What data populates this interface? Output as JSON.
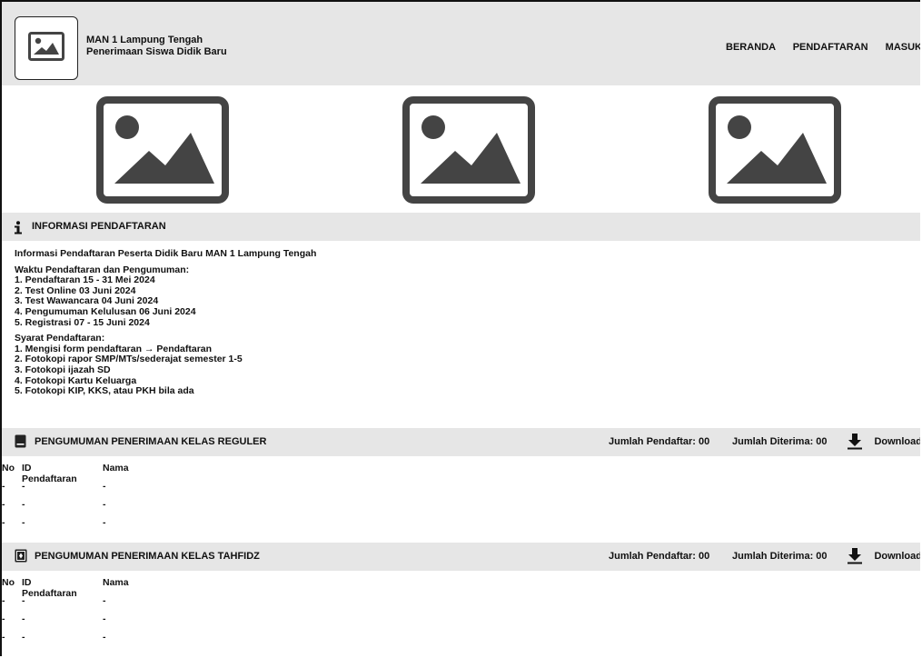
{
  "header": {
    "school_name": "MAN 1 Lampung Tengah",
    "subtitle": "Penerimaan Siswa Didik Baru",
    "nav": [
      "BERANDA",
      "PENDAFTARAN",
      "MASUK"
    ]
  },
  "info_section": {
    "title": "INFORMASI PENDAFTARAN",
    "intro": "Informasi Pendaftaran Peserta Didik Baru MAN 1 Lampung Tengah",
    "schedule_title": "Waktu Pendaftaran dan Pengumuman:",
    "schedule": [
      "1. Pendaftaran 15 - 31 Mei 2024",
      "2. Test Online 03 Juni 2024",
      "3. Test Wawancara 04 Juni 2024",
      "4. Pengumuman Kelulusan 06 Juni 2024",
      "5. Registrasi 07 - 15 Juni 2024"
    ],
    "requirements_title": "Syarat Pendaftaran:",
    "requirements": [
      "1. Mengisi form pendaftaran → Pendaftaran",
      "2. Fotokopi rapor SMP/MTs/sederajat semester 1-5",
      "3. Fotokopi ijazah SD",
      "4. Fotokopi Kartu Keluarga",
      "5. Fotokopi KIP, KKS, atau PKH bila ada"
    ]
  },
  "reguler": {
    "title": "PENGUMUMAN PENERIMAAN KELAS REGULER",
    "jumlah_pendaftar": "Jumlah Pendaftar: 00",
    "jumlah_diterima": "Jumlah Diterima: 00",
    "download": "Download",
    "columns": [
      "No",
      "ID Pendaftaran",
      "Nama"
    ],
    "rows": [
      [
        "-",
        "-",
        "-"
      ],
      [
        "-",
        "-",
        "-"
      ],
      [
        "-",
        "-",
        "-"
      ]
    ]
  },
  "tahfidz": {
    "title": "PENGUMUMAN PENERIMAAN KELAS TAHFIDZ",
    "jumlah_pendaftar": "Jumlah Pendaftar: 00",
    "jumlah_diterima": "Jumlah Diterima: 00",
    "download": "Download",
    "columns": [
      "No",
      "ID Pendaftaran",
      "Nama"
    ],
    "rows": [
      [
        "-",
        "-",
        "-"
      ],
      [
        "-",
        "-",
        "-"
      ],
      [
        "-",
        "-",
        "-"
      ]
    ]
  }
}
